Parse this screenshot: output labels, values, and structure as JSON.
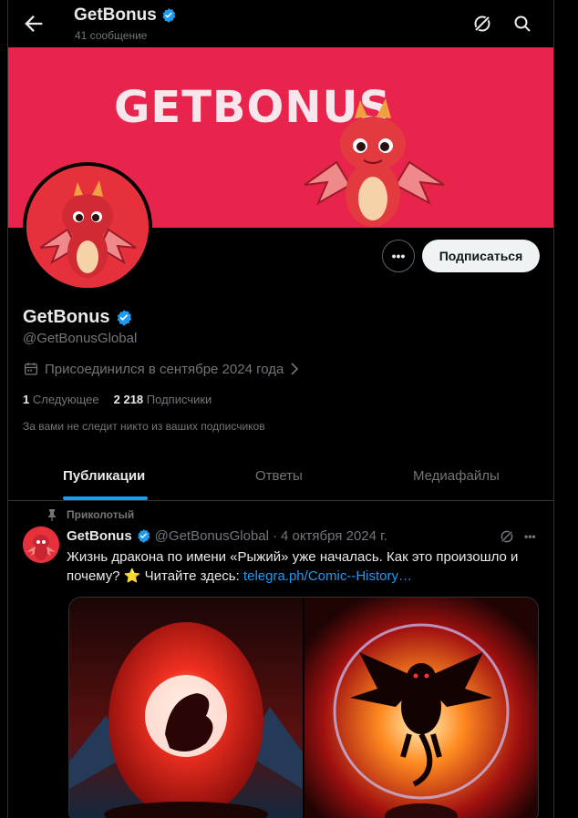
{
  "header": {
    "title": "GetBonus",
    "posts_count": "41 сообщение"
  },
  "banner": {
    "logo_text": "GETBONUS"
  },
  "profile": {
    "name": "GetBonus",
    "handle": "@GetBonusGlobal",
    "joined": "Присоединился в сентябре 2024 года",
    "following_count": "1",
    "following_label": "Следующее",
    "followers_count": "2 218",
    "followers_label": "Подписчики",
    "not_followed_note": "За вами не следит никто из ваших подписчиков",
    "more_label": "•••",
    "subscribe_label": "Подписаться"
  },
  "tabs": [
    {
      "label": "Публикации",
      "active": true
    },
    {
      "label": "Ответы",
      "active": false
    },
    {
      "label": "Медиафайлы",
      "active": false
    }
  ],
  "pinned_tweet": {
    "pinned_label": "Приколотый",
    "author": "GetBonus",
    "handle": "@GetBonusGlobal",
    "separator": "·",
    "date": "4 октября 2024 г.",
    "text": "Жизнь дракона по имени «Рыжий» уже началась. Как это произошло и почему? ⭐  Читайте здесь: ",
    "link": "telegra.ph/Comic--History…",
    "more_label": "•••"
  },
  "icons": {
    "back": "arrow-left-icon",
    "grok": "grok-icon",
    "search": "search-icon",
    "verified": "verified-badge-icon",
    "calendar": "calendar-icon",
    "pin": "pin-icon"
  },
  "colors": {
    "accent": "#1d9bf0",
    "banner": "#e8244c",
    "background": "#000000"
  }
}
